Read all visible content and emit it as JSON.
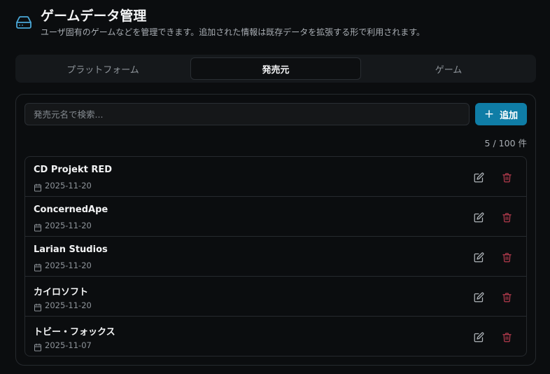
{
  "header": {
    "title": "ゲームデータ管理",
    "subtitle": "ユーザ固有のゲームなどを管理できます。追加された情報は既存データを拡張する形で利用されます。",
    "icon": "hard-drive-icon"
  },
  "tabs": [
    {
      "label": "プラットフォーム",
      "active": false
    },
    {
      "label": "発売元",
      "active": true
    },
    {
      "label": "ゲーム",
      "active": false
    }
  ],
  "search": {
    "placeholder": "発売元名で検索...",
    "value": ""
  },
  "add_button": {
    "label": "追加",
    "icon": "plus-icon"
  },
  "count_text": "5 / 100 件",
  "publishers": [
    {
      "name": "CD Projekt RED",
      "date": "2025-11-20"
    },
    {
      "name": "ConcernedApe",
      "date": "2025-11-20"
    },
    {
      "name": "Larian Studios",
      "date": "2025-11-20"
    },
    {
      "name": "カイロソフト",
      "date": "2025-11-20"
    },
    {
      "name": "トビー・フォックス",
      "date": "2025-11-07"
    }
  ],
  "colors": {
    "accent": "#0f7da6",
    "delete": "#b23a4c",
    "background": "#0b0d0f"
  }
}
